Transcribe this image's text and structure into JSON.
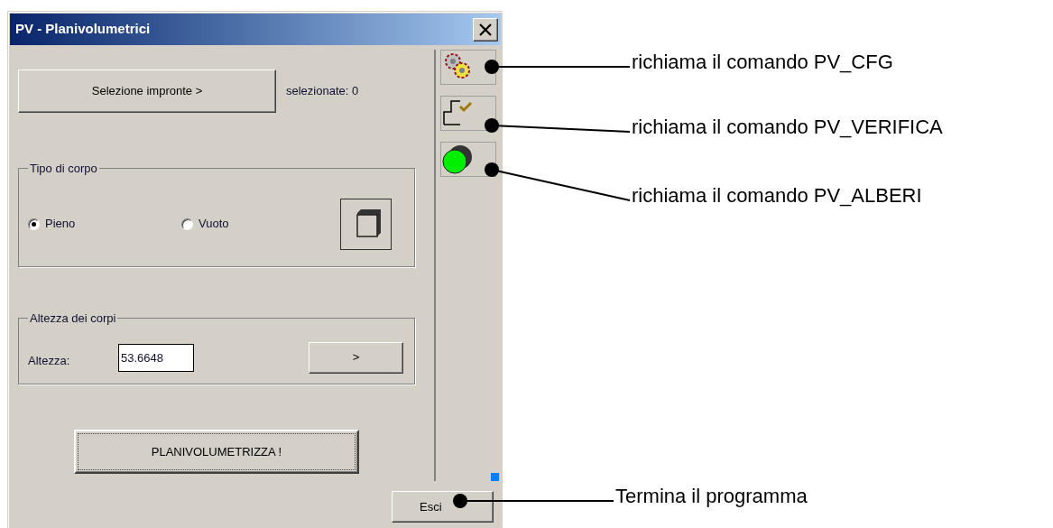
{
  "window": {
    "title": "PV - Planivolumetrici"
  },
  "selection": {
    "button": "Selezione impronte >",
    "count": "selezionate: 0"
  },
  "body_type": {
    "legend": "Tipo di corpo",
    "options": [
      {
        "label": "Pieno",
        "selected": true
      },
      {
        "label": "Vuoto",
        "selected": false
      }
    ]
  },
  "height": {
    "legend": "Altezza dei corpi",
    "label": "Altezza:",
    "value": "53.6648",
    "button": ">"
  },
  "run_button": "PLANIVOLUMETRIZZA !",
  "toolbar": [
    {
      "kind": "gears"
    },
    {
      "kind": "check"
    },
    {
      "kind": "light"
    }
  ],
  "exit_button": "Esci",
  "annotations": [
    {
      "text": "richiama il comando PV_CFG"
    },
    {
      "text": "richiama il comando PV_VERIFICA"
    },
    {
      "text": "richiama il comando PV_ALBERI"
    },
    {
      "text": "Termina il programma"
    }
  ]
}
